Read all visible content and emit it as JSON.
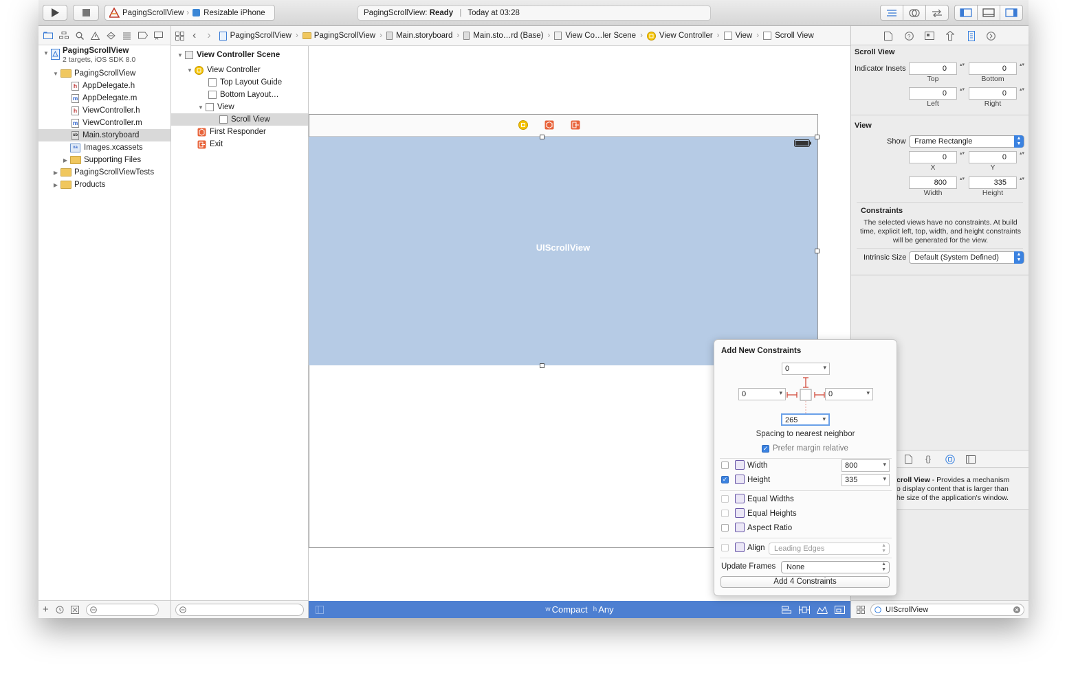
{
  "toolbar": {
    "scheme_target": "PagingScrollView",
    "scheme_device": "Resizable iPhone",
    "status_app": "PagingScrollView:",
    "status_state": "Ready",
    "status_time": "Today at 03:28"
  },
  "jumpbar": {
    "crumbs": [
      "PagingScrollView",
      "PagingScrollView",
      "Main.storyboard",
      "Main.sto…rd (Base)",
      "View Co…ler Scene",
      "View Controller",
      "View",
      "Scroll View"
    ]
  },
  "navigator": {
    "project_name": "PagingScrollView",
    "project_sub": "2 targets, iOS SDK 8.0",
    "group": "PagingScrollView",
    "files": [
      {
        "name": "AppDelegate.h",
        "badge": "h"
      },
      {
        "name": "AppDelegate.m",
        "badge": "m"
      },
      {
        "name": "ViewController.h",
        "badge": "h"
      },
      {
        "name": "ViewController.m",
        "badge": "m"
      },
      {
        "name": "Main.storyboard",
        "badge": "sb"
      },
      {
        "name": "Images.xcassets",
        "badge": "xa"
      }
    ],
    "supporting": "Supporting Files",
    "tests": "PagingScrollViewTests",
    "products": "Products"
  },
  "outline": {
    "scene": "View Controller Scene",
    "vc": "View Controller",
    "top_guide": "Top Layout Guide",
    "bottom_guide": "Bottom Layout…",
    "view": "View",
    "scroll_view": "Scroll View",
    "first_responder": "First Responder",
    "exit": "Exit"
  },
  "canvas": {
    "scroll_label": "UIScrollView",
    "size_w_prefix": "w",
    "size_w": "Compact",
    "size_h_prefix": "h",
    "size_h": "Any"
  },
  "inspector": {
    "scroll_title": "Scroll View",
    "indicator_label": "Indicator Insets",
    "insets": {
      "top": "0",
      "bottom": "0",
      "left": "0",
      "right": "0"
    },
    "inset_labels": {
      "top": "Top",
      "bottom": "Bottom",
      "left": "Left",
      "right": "Right"
    },
    "view_title": "View",
    "show_label": "Show",
    "show_value": "Frame Rectangle",
    "frame": {
      "x": "0",
      "y": "0",
      "width": "800",
      "height": "335"
    },
    "frame_labels": {
      "x": "X",
      "y": "Y",
      "width": "Width",
      "height": "Height"
    },
    "constraints_title": "Constraints",
    "constraints_text": "The selected views have no constraints. At build time, explicit left, top, width, and height constraints will be generated for the view.",
    "intrinsic_label": "Intrinsic Size",
    "intrinsic_value": "Default (System Defined)",
    "lib_title": "croll View",
    "lib_desc_1": " - Provides a mechanism",
    "lib_desc_2": "o display content that is larger than",
    "lib_desc_3": "he size of the application's window.",
    "filter_value": "UIScrollView"
  },
  "popover": {
    "title": "Add New Constraints",
    "top": "0",
    "left": "0",
    "right": "0",
    "bottom": "265",
    "spacing_caption": "Spacing to nearest neighbor",
    "prefer_margin": "Prefer margin relative",
    "width_label": "Width",
    "width_value": "800",
    "height_label": "Height",
    "height_value": "335",
    "equal_widths": "Equal Widths",
    "equal_heights": "Equal Heights",
    "aspect_ratio": "Aspect Ratio",
    "align_label": "Align",
    "align_value": "Leading Edges",
    "update_label": "Update Frames",
    "update_value": "None",
    "add_button": "Add 4 Constraints"
  }
}
